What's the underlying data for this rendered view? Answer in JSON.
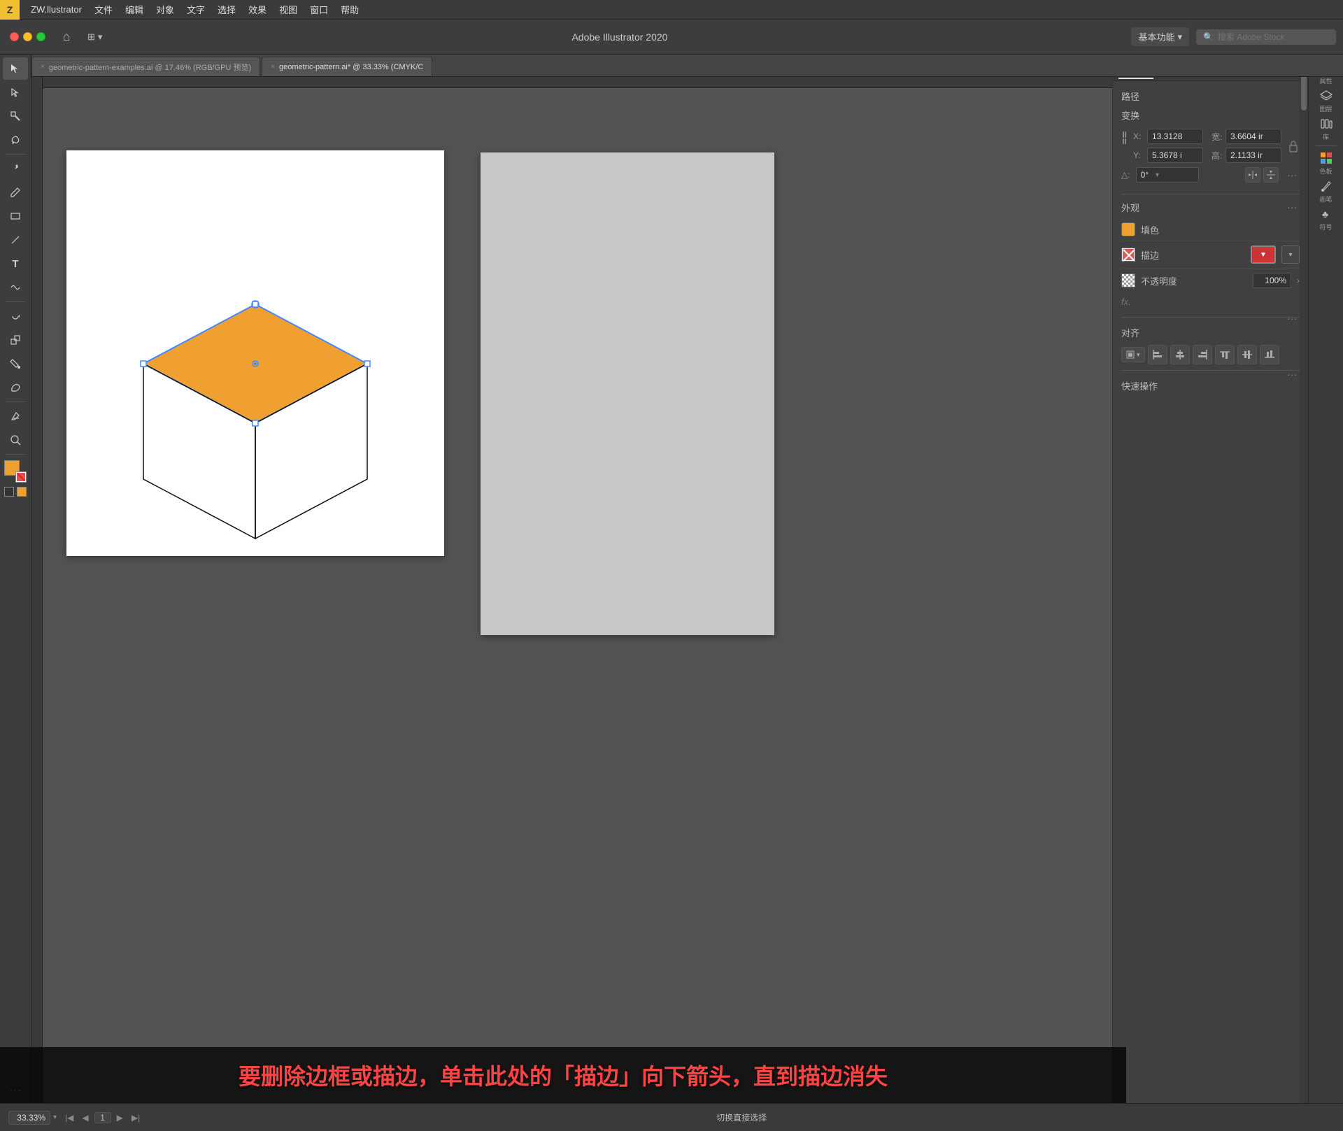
{
  "menubar": {
    "logo": "Z",
    "items": [
      "ZW.llustrator",
      "文件",
      "编辑",
      "对象",
      "文字",
      "选择",
      "效果",
      "视图",
      "窗口",
      "帮助"
    ]
  },
  "titlebar": {
    "app_title": "Adobe Illustrator 2020",
    "workspace_label": "基本功能",
    "search_placeholder": "搜索 Adobe Stock"
  },
  "tabs": [
    {
      "label": "geometric-pattern-examples.ai @ 17.46% (RGB/GPU 预览)",
      "active": false
    },
    {
      "label": "geometric-pattern.ai* @ 33.33% (CMYK/C",
      "active": true
    }
  ],
  "right_panel": {
    "tabs": [
      "属性",
      "图层",
      "库"
    ],
    "section_path": "路径",
    "section_transform": "变换",
    "transform": {
      "x_label": "X:",
      "x_value": "13.3128",
      "y_label": "Y:",
      "y_value": "5.3678 i",
      "w_label": "宽:",
      "w_value": "3.6604 ir",
      "h_label": "高:",
      "h_value": "2.1133 ir",
      "angle_label": "△:",
      "angle_value": "0°"
    },
    "appearance": {
      "section_label": "外观",
      "fill_label": "填色",
      "stroke_label": "描边",
      "opacity_label": "不透明度",
      "opacity_value": "100%",
      "fx_label": "fx."
    },
    "align": {
      "section_label": "对齐"
    },
    "quick_actions": {
      "section_label": "快速操作"
    }
  },
  "right_strip": {
    "items": [
      {
        "label": "属性",
        "icon": "属"
      },
      {
        "label": "图层",
        "icon": "图"
      },
      {
        "label": "库",
        "icon": "库"
      },
      {
        "sep": true
      },
      {
        "label": "色板",
        "icon": "色"
      },
      {
        "label": "画笔",
        "icon": "画"
      },
      {
        "label": "符号",
        "icon": "符"
      }
    ]
  },
  "statusbar": {
    "zoom_value": "33.33%",
    "page_number": "1",
    "tool_name": "切换直接选择"
  },
  "annotation": {
    "text": "要删除边框或描边，单击此处的「描边」向下箭头，直到描边消失"
  },
  "tools": {
    "items": [
      "▶",
      "↗",
      "⊡",
      "✦",
      "✒",
      "✏",
      "⊿",
      "T",
      "⌒",
      "◉",
      "✦",
      "✿",
      "⊙",
      "🔍",
      "◻",
      "⌖",
      "⊕"
    ]
  }
}
